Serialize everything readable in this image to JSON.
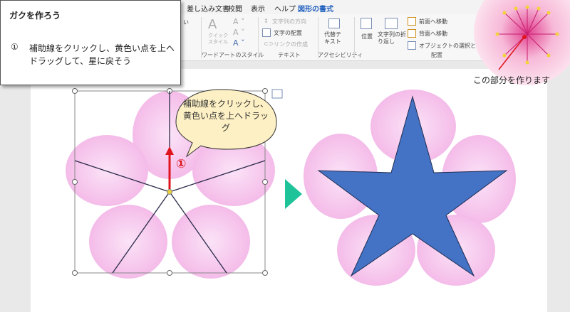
{
  "ribbon": {
    "tabs": [
      {
        "label": "差し込み文書"
      },
      {
        "label": "校閲"
      },
      {
        "label": "表示"
      },
      {
        "label": "ヘルプ"
      },
      {
        "label": "図形の書式"
      }
    ],
    "cut_label": "い",
    "quick_style_label": "クイック\nスタイル",
    "wordart_group": "ワードアートのスタイル",
    "text_direction": "文字列の方向",
    "text_align": "文字の配置",
    "create_link": "リンクの作成",
    "text_group": "テキスト",
    "alt_text": "代替テ\nキスト",
    "accessibility_group": "アクセシビリティ",
    "position": "位置",
    "wrap_text": "文字列の折\nり返し",
    "bring_forward": "前面へ移動",
    "send_backward": "背面へ移動",
    "selection_pane": "オブジェクトの選択と表...",
    "arrange_group": "配置"
  },
  "instruction": {
    "title": "ガクを作ろう",
    "step_number": "①",
    "step_text": "補助線をクリックし、黄色い点を上へドラッグして、星に戻そう"
  },
  "bubble": {
    "text": "補助線をクリックし、黄色い点を上へドラッグ"
  },
  "marker": {
    "text": "①"
  },
  "note": {
    "text": "この部分を作ります"
  },
  "colors": {
    "star": "#4472c4",
    "petal": "#f6c4ec",
    "arrow": "#e0141e",
    "handle": "#e8d23a",
    "next_arrow": "#1ec39a"
  }
}
